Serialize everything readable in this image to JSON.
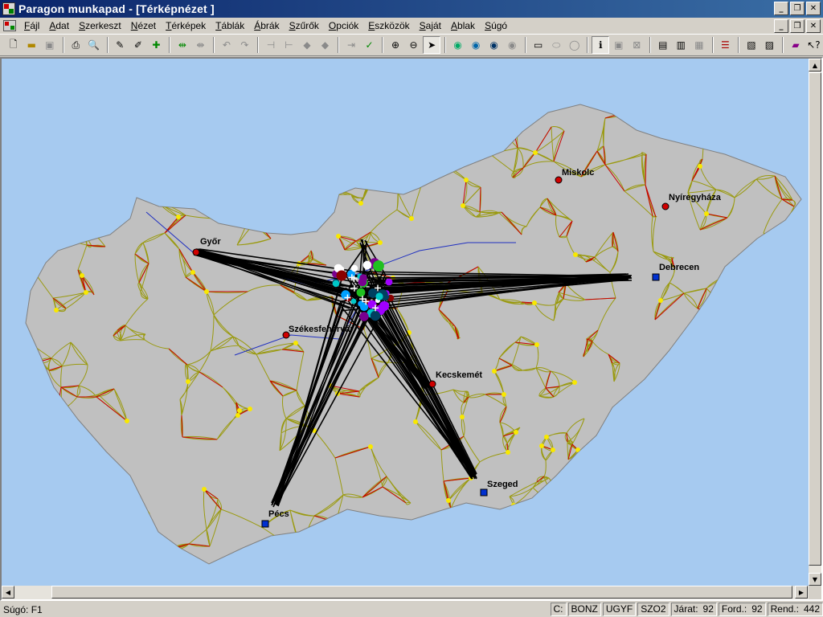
{
  "window": {
    "title": "Paragon munkapad - [Térképnézet ]"
  },
  "menu": [
    "Fájl",
    "Adat",
    "Szerkeszt",
    "Nézet",
    "Térképek",
    "Táblák",
    "Ábrák",
    "Szűrők",
    "Opciók",
    "Eszközök",
    "Saját",
    "Ablak",
    "Súgó"
  ],
  "map": {
    "cities": [
      {
        "name": "Miskolc",
        "marker": "red"
      },
      {
        "name": "Nyíregyháza",
        "marker": "red"
      },
      {
        "name": "Győr",
        "marker": "red"
      },
      {
        "name": "Debrecen",
        "marker": "blue"
      },
      {
        "name": "Székesfehérvár",
        "marker": "red"
      },
      {
        "name": "Kecskemét",
        "marker": "red"
      },
      {
        "name": "Szeged",
        "marker": "blue"
      },
      {
        "name": "Pécs",
        "marker": "blue"
      }
    ]
  },
  "status": {
    "help": "Súgó: F1",
    "c": "C:",
    "codes": [
      "BONZ",
      "UGYF",
      "SZO2"
    ],
    "jarat_label": "Járat:",
    "jarat_value": "92",
    "ford_label": "Ford.:",
    "ford_value": "92",
    "rend_label": "Rend.:",
    "rend_value": "442"
  },
  "colors": {
    "map_background": "#a6caf0",
    "land": "#c0c0c0",
    "title_gradient_start": "#0a246a"
  }
}
